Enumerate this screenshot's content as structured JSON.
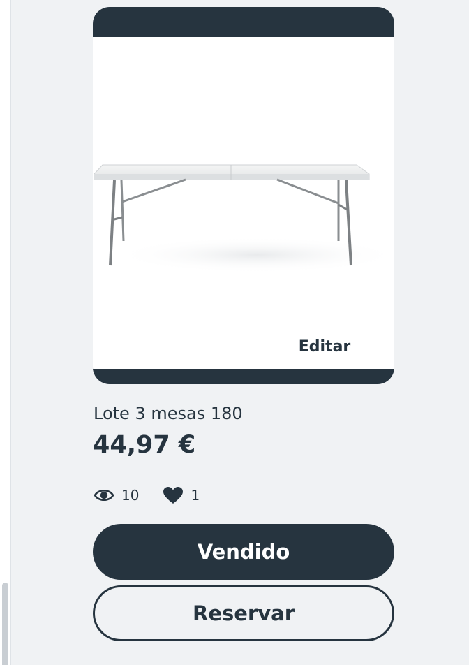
{
  "product": {
    "edit_label": "Editar",
    "title": "Lote 3 mesas 180",
    "price": "44,97 €",
    "views_icon": "eye-icon",
    "views_count": "10",
    "likes_icon": "heart-icon",
    "likes_count": "1"
  },
  "actions": {
    "sold_label": "Vendido",
    "reserve_label": "Reservar"
  },
  "colors": {
    "primary": "#26343f",
    "background": "#f0f2f4",
    "surface": "#ffffff"
  }
}
